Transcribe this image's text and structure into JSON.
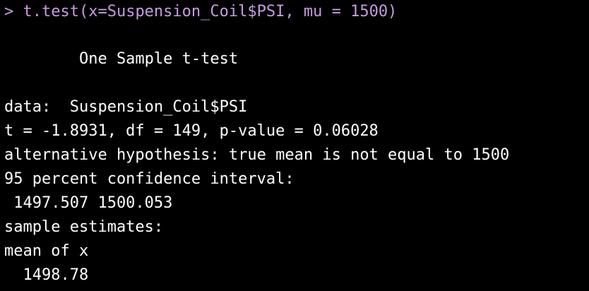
{
  "console": {
    "prompt": "> ",
    "command": "t.test(x=Suspension_Coil$PSI, mu = 1500)",
    "output": {
      "title": "        One Sample t-test",
      "data_line": "data:  Suspension_Coil$PSI",
      "stats_line": "t = -1.8931, df = 149, p-value = 0.06028",
      "alternative_line": "alternative hypothesis: true mean is not equal to 1500",
      "ci_label": "95 percent confidence interval:",
      "ci_values": " 1497.507 1500.053",
      "estimates_label": "sample estimates:",
      "estimate_name": "mean of x",
      "estimate_value": "  1498.78"
    },
    "colors": {
      "background": "#000000",
      "command_text": "#c99be3",
      "output_text": "#ffffff"
    }
  }
}
